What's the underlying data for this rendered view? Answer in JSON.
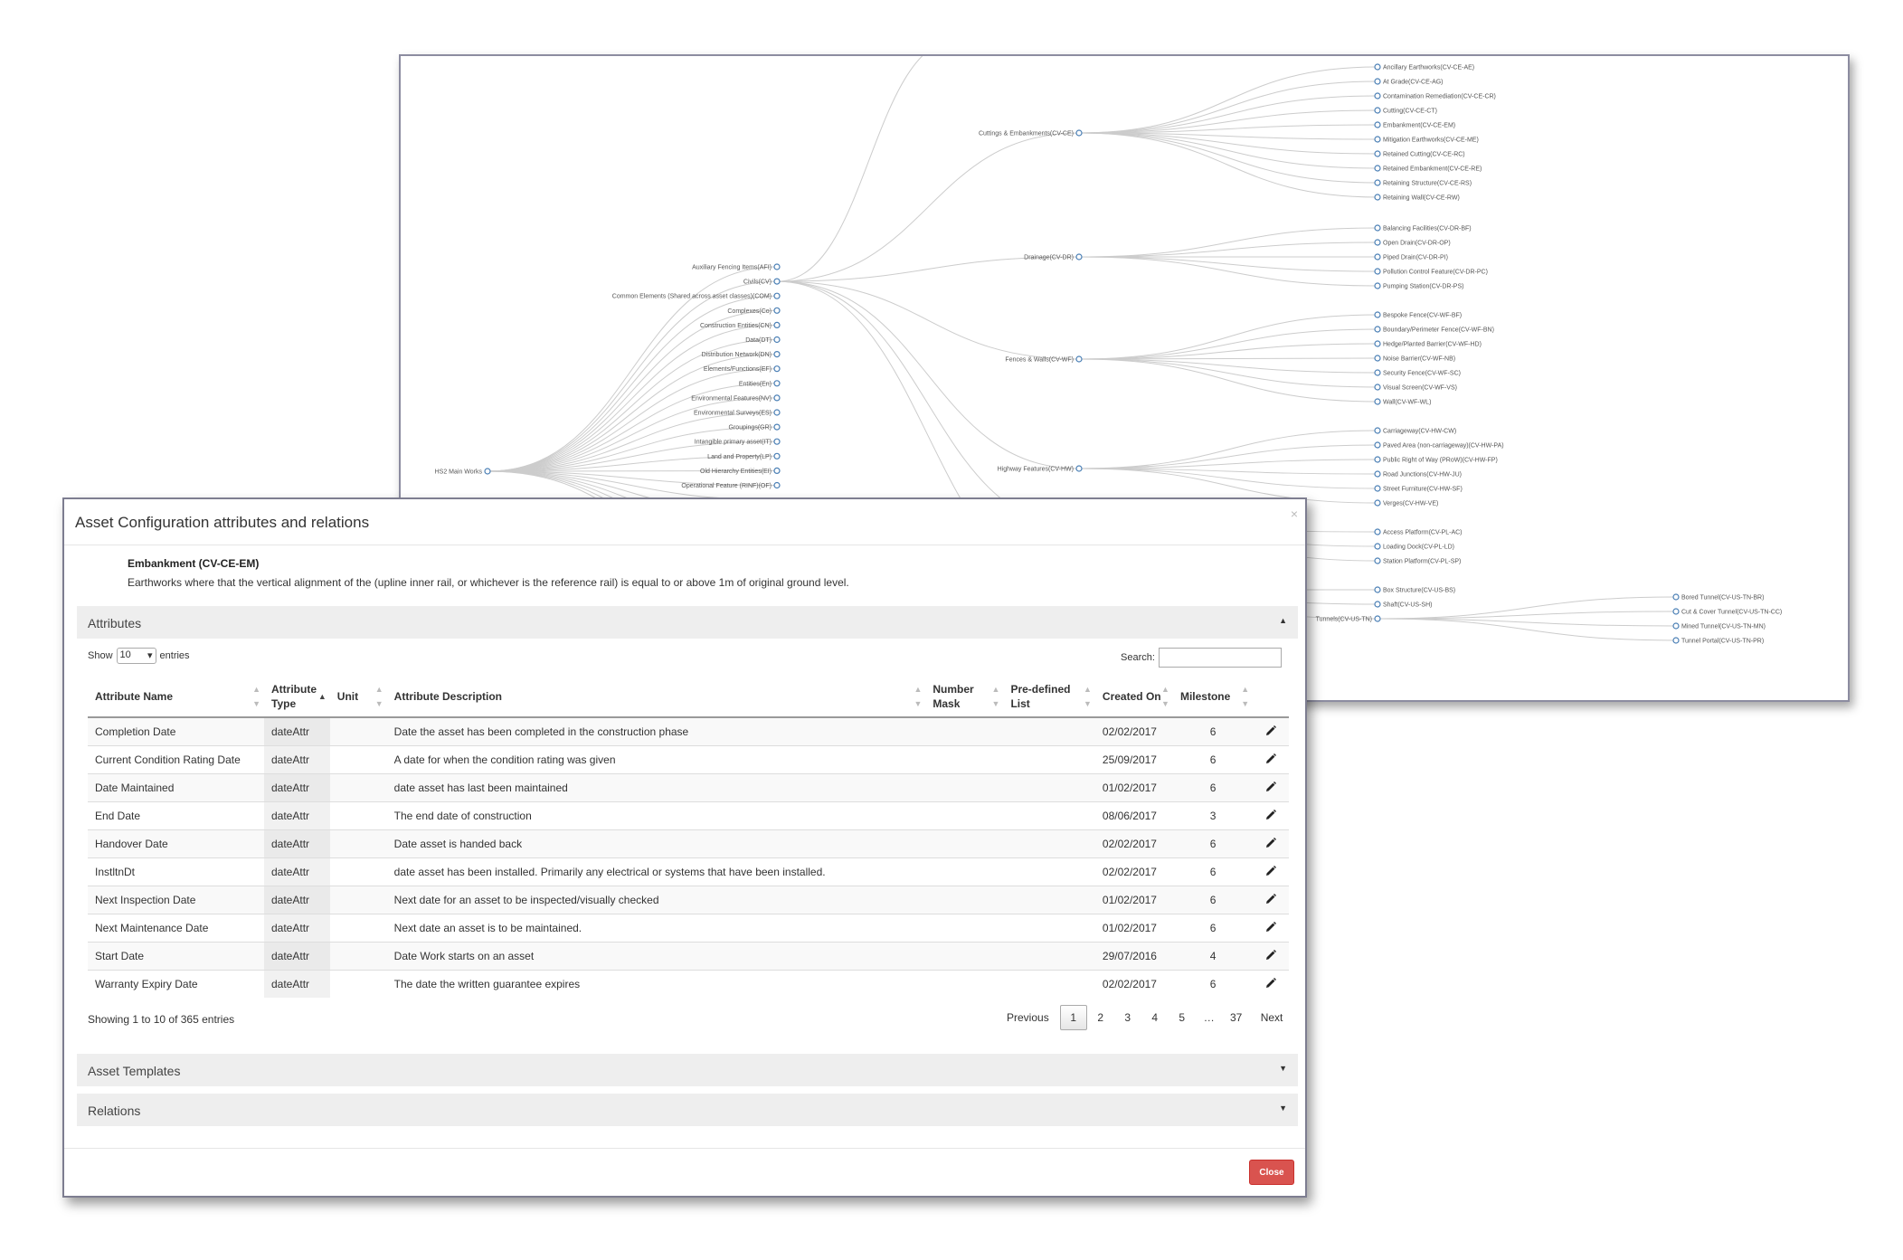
{
  "tree": {
    "root": "HS2 Main Works",
    "level1": [
      "Auxiliary Fencing Items(AFI)",
      "Civils(CV)",
      "Common Elements (Shared across asset classes)(COM)",
      "Complexes(Co)",
      "Construction Entities(CN)",
      "Data(DT)",
      "Distribution Network(DN)",
      "Elements/Functions(EF)",
      "Entities(En)",
      "Environmental Features(NV)",
      "Environmental Surveys(ES)",
      "Groupings(GR)",
      "Intangible primary asset(IT)",
      "Land and Property(LP)",
      "Old Hierarchy Entities(EI)",
      "Operational Feature (RINF)(OF)"
    ],
    "groups": [
      {
        "label": "Cuttings & Embankments(CV-CE)",
        "children": [
          "Ancillary Earthworks(CV-CE-AE)",
          "At Grade(CV-CE-AG)",
          "Contamination Remediation(CV-CE-CR)",
          "Cutting(CV-CE-CT)",
          "Embankment(CV-CE-EM)",
          "Mitigation Earthworks(CV-CE-ME)",
          "Retained Cutting(CV-CE-RC)",
          "Retained Embankment(CV-CE-RE)",
          "Retaining Structure(CV-CE-RS)",
          "Retaining Wall(CV-CE-RW)"
        ]
      },
      {
        "label": "Drainage(CV-DR)",
        "children": [
          "Balancing Facilities(CV-DR-BF)",
          "Open Drain(CV-DR-OP)",
          "Piped Drain(CV-DR-PI)",
          "Pollution Control Feature(CV-DR-PC)",
          "Pumping Station(CV-DR-PS)"
        ]
      },
      {
        "label": "Fences & Walls(CV-WF)",
        "children": [
          "Bespoke Fence(CV-WF-BF)",
          "Boundary/Perimeter Fence(CV-WF-BN)",
          "Hedge/Planted Barrier(CV-WF-HD)",
          "Noise Barrier(CV-WF-NB)",
          "Security Fence(CV-WF-SC)",
          "Visual Screen(CV-WF-VS)",
          "Wall(CV-WF-WL)"
        ]
      },
      {
        "label": "Highway Features(CV-HW)",
        "children": [
          "Carriageway(CV-HW-CW)",
          "Paved Area (non-carriageway)(CV-HW-PA)",
          "Public Right of Way (PRoW)(CV-HW-FP)",
          "Road Junctions(CV-HW-JU)",
          "Street Furniture(CV-HW-SF)",
          "Verges(CV-HW-VE)"
        ]
      },
      {
        "label": "",
        "children": [
          "Access Platform(CV-PL-AC)",
          "Loading Dock(CV-PL-LD)",
          "Station Platform(CV-PL-SP)"
        ]
      },
      {
        "label": "",
        "children": [
          "Box Structure(CV-US-BS)",
          "Shaft(CV-US-SH)"
        ]
      }
    ],
    "tunnels": {
      "label": "Tunnels(CV-US-TN)",
      "children": [
        "Bored Tunnel(CV-US-TN-BR)",
        "Cut & Cover Tunnel(CV-US-TN-CC)",
        "Mined Tunnel(CV-US-TN-MN)",
        "Tunnel Portal(CV-US-TN-PR)"
      ]
    }
  },
  "modal": {
    "title": "Asset Configuration attributes and relations",
    "close_x": "×",
    "asset_name": "Embankment (CV-CE-EM)",
    "asset_description": "Earthworks where that the vertical alignment of the (upline inner rail, or whichever is the reference rail) is equal to or above 1m of original ground level.",
    "attributes_title": "Attributes",
    "show_label": "Show",
    "page_size": "10",
    "entries_label": "entries",
    "search_label": "Search:",
    "columns": [
      "Attribute Name",
      "Attribute Type",
      "Unit",
      "Attribute Description",
      "Number Mask",
      "Pre-defined List",
      "Created On",
      "Milestone"
    ],
    "rows": [
      {
        "name": "Completion Date",
        "type": "dateAttr",
        "unit": "",
        "desc": "Date the asset has been completed in the construction phase",
        "mask": "",
        "list": "",
        "created": "02/02/2017",
        "milestone": "6"
      },
      {
        "name": "Current Condition Rating Date",
        "type": "dateAttr",
        "unit": "",
        "desc": "A date for when the condition rating was given",
        "mask": "",
        "list": "",
        "created": "25/09/2017",
        "milestone": "6"
      },
      {
        "name": "Date Maintained",
        "type": "dateAttr",
        "unit": "",
        "desc": "date asset has last been maintained",
        "mask": "",
        "list": "",
        "created": "01/02/2017",
        "milestone": "6"
      },
      {
        "name": "End Date",
        "type": "dateAttr",
        "unit": "",
        "desc": "The end date of construction",
        "mask": "",
        "list": "",
        "created": "08/06/2017",
        "milestone": "3"
      },
      {
        "name": "Handover Date",
        "type": "dateAttr",
        "unit": "",
        "desc": "Date asset is handed back",
        "mask": "",
        "list": "",
        "created": "02/02/2017",
        "milestone": "6"
      },
      {
        "name": "InstltnDt",
        "type": "dateAttr",
        "unit": "",
        "desc": "date asset has been installed. Primarily any electrical or systems that have been installed.",
        "mask": "",
        "list": "",
        "created": "02/02/2017",
        "milestone": "6"
      },
      {
        "name": "Next Inspection Date",
        "type": "dateAttr",
        "unit": "",
        "desc": "Next date for an asset to be inspected/visually checked",
        "mask": "",
        "list": "",
        "created": "01/02/2017",
        "milestone": "6"
      },
      {
        "name": "Next Maintenance Date",
        "type": "dateAttr",
        "unit": "",
        "desc": "Next date an asset is to be maintained.",
        "mask": "",
        "list": "",
        "created": "01/02/2017",
        "milestone": "6"
      },
      {
        "name": "Start Date",
        "type": "dateAttr",
        "unit": "",
        "desc": "Date Work starts on an asset",
        "mask": "",
        "list": "",
        "created": "29/07/2016",
        "milestone": "4"
      },
      {
        "name": "Warranty Expiry Date",
        "type": "dateAttr",
        "unit": "",
        "desc": "The date the written guarantee expires",
        "mask": "",
        "list": "",
        "created": "02/02/2017",
        "milestone": "6"
      }
    ],
    "info": "Showing 1 to 10 of 365 entries",
    "pager": [
      "Previous",
      "1",
      "2",
      "3",
      "4",
      "5",
      "…",
      "37",
      "Next"
    ],
    "current_page": "1",
    "templates_title": "Asset Templates",
    "relations_title": "Relations",
    "close_label": "Close",
    "colors": {
      "close_button": "#d9534f",
      "panel_bar": "#eeeeee",
      "tree_node": "#4a7fb5"
    }
  }
}
